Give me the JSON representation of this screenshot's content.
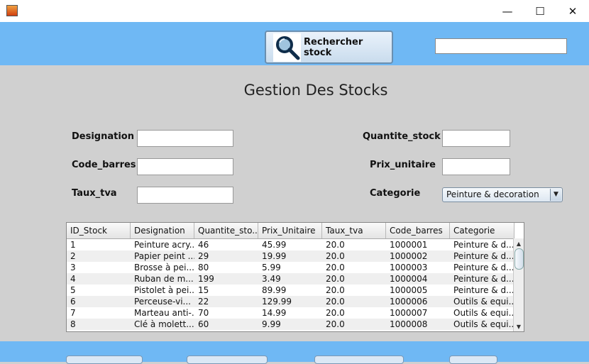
{
  "window": {
    "minimize": "—",
    "maximize": "☐",
    "close": "✕"
  },
  "header": {
    "search_button": {
      "label": "Rechercher stock",
      "icon": "magnifier-icon"
    },
    "search_input": {
      "value": ""
    }
  },
  "page_title": "Gestion Des Stocks",
  "form": {
    "designation": {
      "label": "Designation",
      "value": ""
    },
    "code_barres": {
      "label": "Code_barres",
      "value": ""
    },
    "taux_tva": {
      "label": "Taux_tva",
      "value": ""
    },
    "quantite_stock": {
      "label": "Quantite_stock",
      "value": ""
    },
    "prix_unitaire": {
      "label": "Prix_unitaire",
      "value": ""
    },
    "categorie": {
      "label": "Categorie",
      "selected": "Peinture & decoration"
    }
  },
  "table": {
    "columns": [
      "ID_Stock",
      "Designation",
      "Quantite_sto...",
      "Prix_Unitaire",
      "Taux_tva",
      "Code_barres",
      "Categorie"
    ],
    "rows": [
      [
        "1",
        "Peinture acry...",
        "46",
        "45.99",
        "20.0",
        "1000001",
        "Peinture & d..."
      ],
      [
        "2",
        "Papier peint ...",
        "29",
        "19.99",
        "20.0",
        "1000002",
        "Peinture & d..."
      ],
      [
        "3",
        "Brosse à pei...",
        "80",
        "5.99",
        "20.0",
        "1000003",
        "Peinture & d..."
      ],
      [
        "4",
        "Ruban de m...",
        "199",
        "3.49",
        "20.0",
        "1000004",
        "Peinture & d..."
      ],
      [
        "5",
        "Pistolet à pei...",
        "15",
        "89.99",
        "20.0",
        "1000005",
        "Peinture & d..."
      ],
      [
        "6",
        "Perceuse-vi...",
        "22",
        "129.99",
        "20.0",
        "1000006",
        "Outils & equi..."
      ],
      [
        "7",
        "Marteau anti-...",
        "70",
        "14.99",
        "20.0",
        "1000007",
        "Outils & equi..."
      ],
      [
        "8",
        "Clé à molett...",
        "60",
        "9.99",
        "20.0",
        "1000008",
        "Outils & equi..."
      ]
    ]
  },
  "colors": {
    "band": "#6fb8f4",
    "background": "#d0d0d0"
  }
}
